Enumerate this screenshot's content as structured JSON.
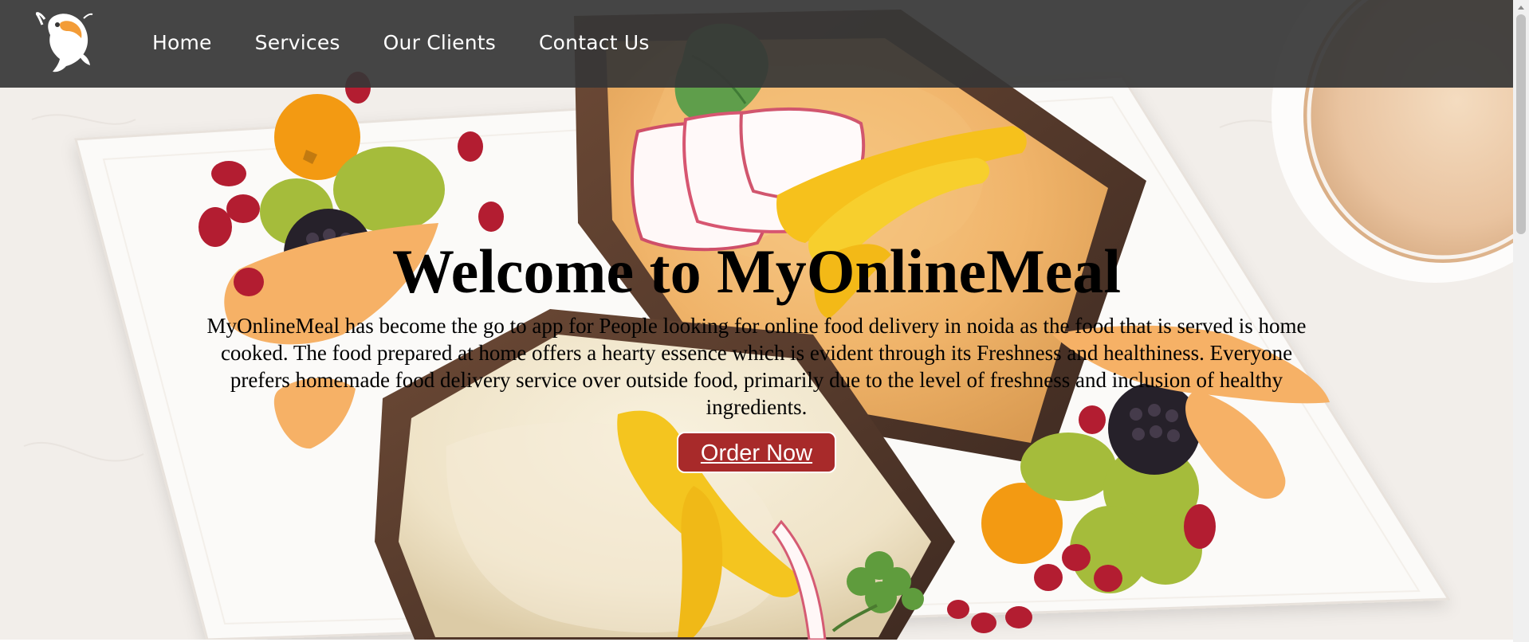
{
  "brand": {
    "logo_icon": "fish-icon"
  },
  "nav": {
    "items": [
      {
        "label": "Home"
      },
      {
        "label": "Services"
      },
      {
        "label": "Our Clients"
      },
      {
        "label": "Contact Us"
      }
    ]
  },
  "hero": {
    "title": "Welcome to MyOnlineMeal",
    "description": "MyOnlineMeal has become the go to app for People looking for online food delivery in noida as the food that is served is home cooked. The food prepared at home offers a hearty essence which is evident through its Freshness and healthiness. Everyone prefers homemade food delivery service over outside food, primarily due to the level of freshness and inclusion of healthy ingredients.",
    "cta_label": "Order Now",
    "background_image": "food-platter-image"
  },
  "colors": {
    "topbar": "#363636",
    "accent": "#a82a2a",
    "text": "#000000"
  }
}
